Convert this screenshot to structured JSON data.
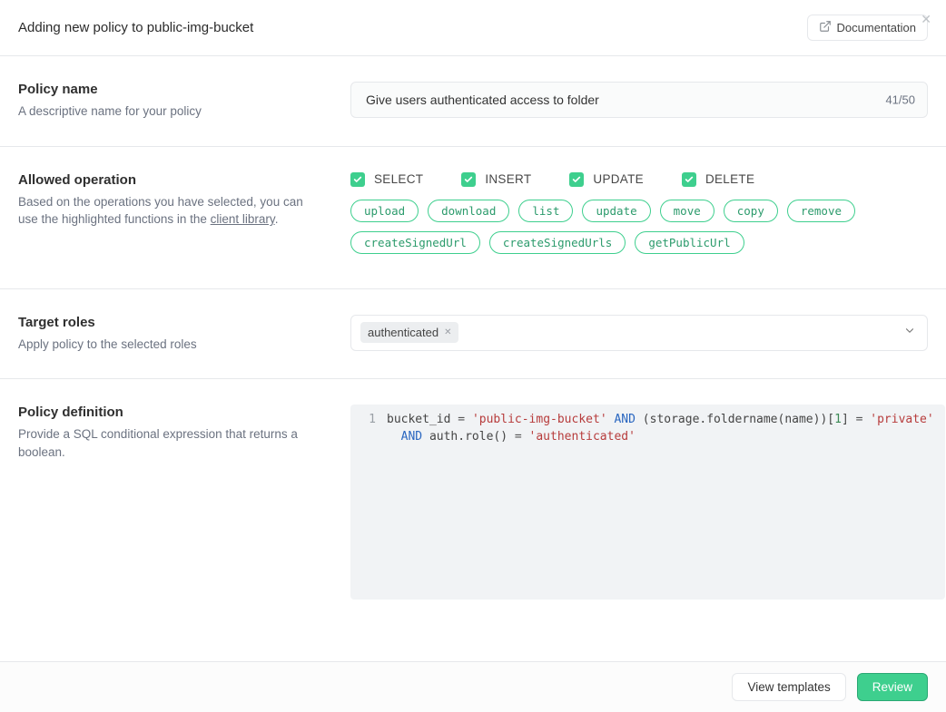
{
  "header": {
    "title": "Adding new policy to public-img-bucket",
    "documentation_label": "Documentation"
  },
  "policy_name": {
    "title": "Policy name",
    "description": "A descriptive name for your policy",
    "value": "Give users authenticated access to folder",
    "char_count": "41/50"
  },
  "allowed_operation": {
    "title": "Allowed operation",
    "description_pre": "Based on the operations you have selected, you can use the highlighted functions in the ",
    "description_link": "client library",
    "description_post": ".",
    "checks": [
      {
        "key": "select",
        "label": "SELECT",
        "checked": true
      },
      {
        "key": "insert",
        "label": "INSERT",
        "checked": true
      },
      {
        "key": "update",
        "label": "UPDATE",
        "checked": true
      },
      {
        "key": "delete",
        "label": "DELETE",
        "checked": true
      }
    ],
    "fn_row1": [
      "upload",
      "download",
      "list",
      "update",
      "move",
      "copy",
      "remove"
    ],
    "fn_row2": [
      "createSignedUrl",
      "createSignedUrls",
      "getPublicUrl"
    ]
  },
  "target_roles": {
    "title": "Target roles",
    "description": "Apply policy to the selected roles",
    "chips": [
      "authenticated"
    ]
  },
  "policy_definition": {
    "title": "Policy definition",
    "description": "Provide a SQL conditional expression that returns a boolean.",
    "gutter": [
      "1"
    ],
    "code": {
      "l1": {
        "a": "bucket_id ",
        "eq": "=",
        "sp1": " ",
        "s1": "'public-img-bucket'",
        "sp2": " ",
        "and": "AND",
        "sp3": " (storage.foldername(name))[",
        "n1": "1",
        "br": "] ",
        "eq2": "=",
        "sp4": " ",
        "s2": "'private'"
      },
      "l2": {
        "and": "AND",
        "sp1": " auth.role() ",
        "eq": "=",
        "sp2": " ",
        "s1": "'authenticated'"
      }
    }
  },
  "footer": {
    "view_templates": "View templates",
    "review": "Review"
  }
}
